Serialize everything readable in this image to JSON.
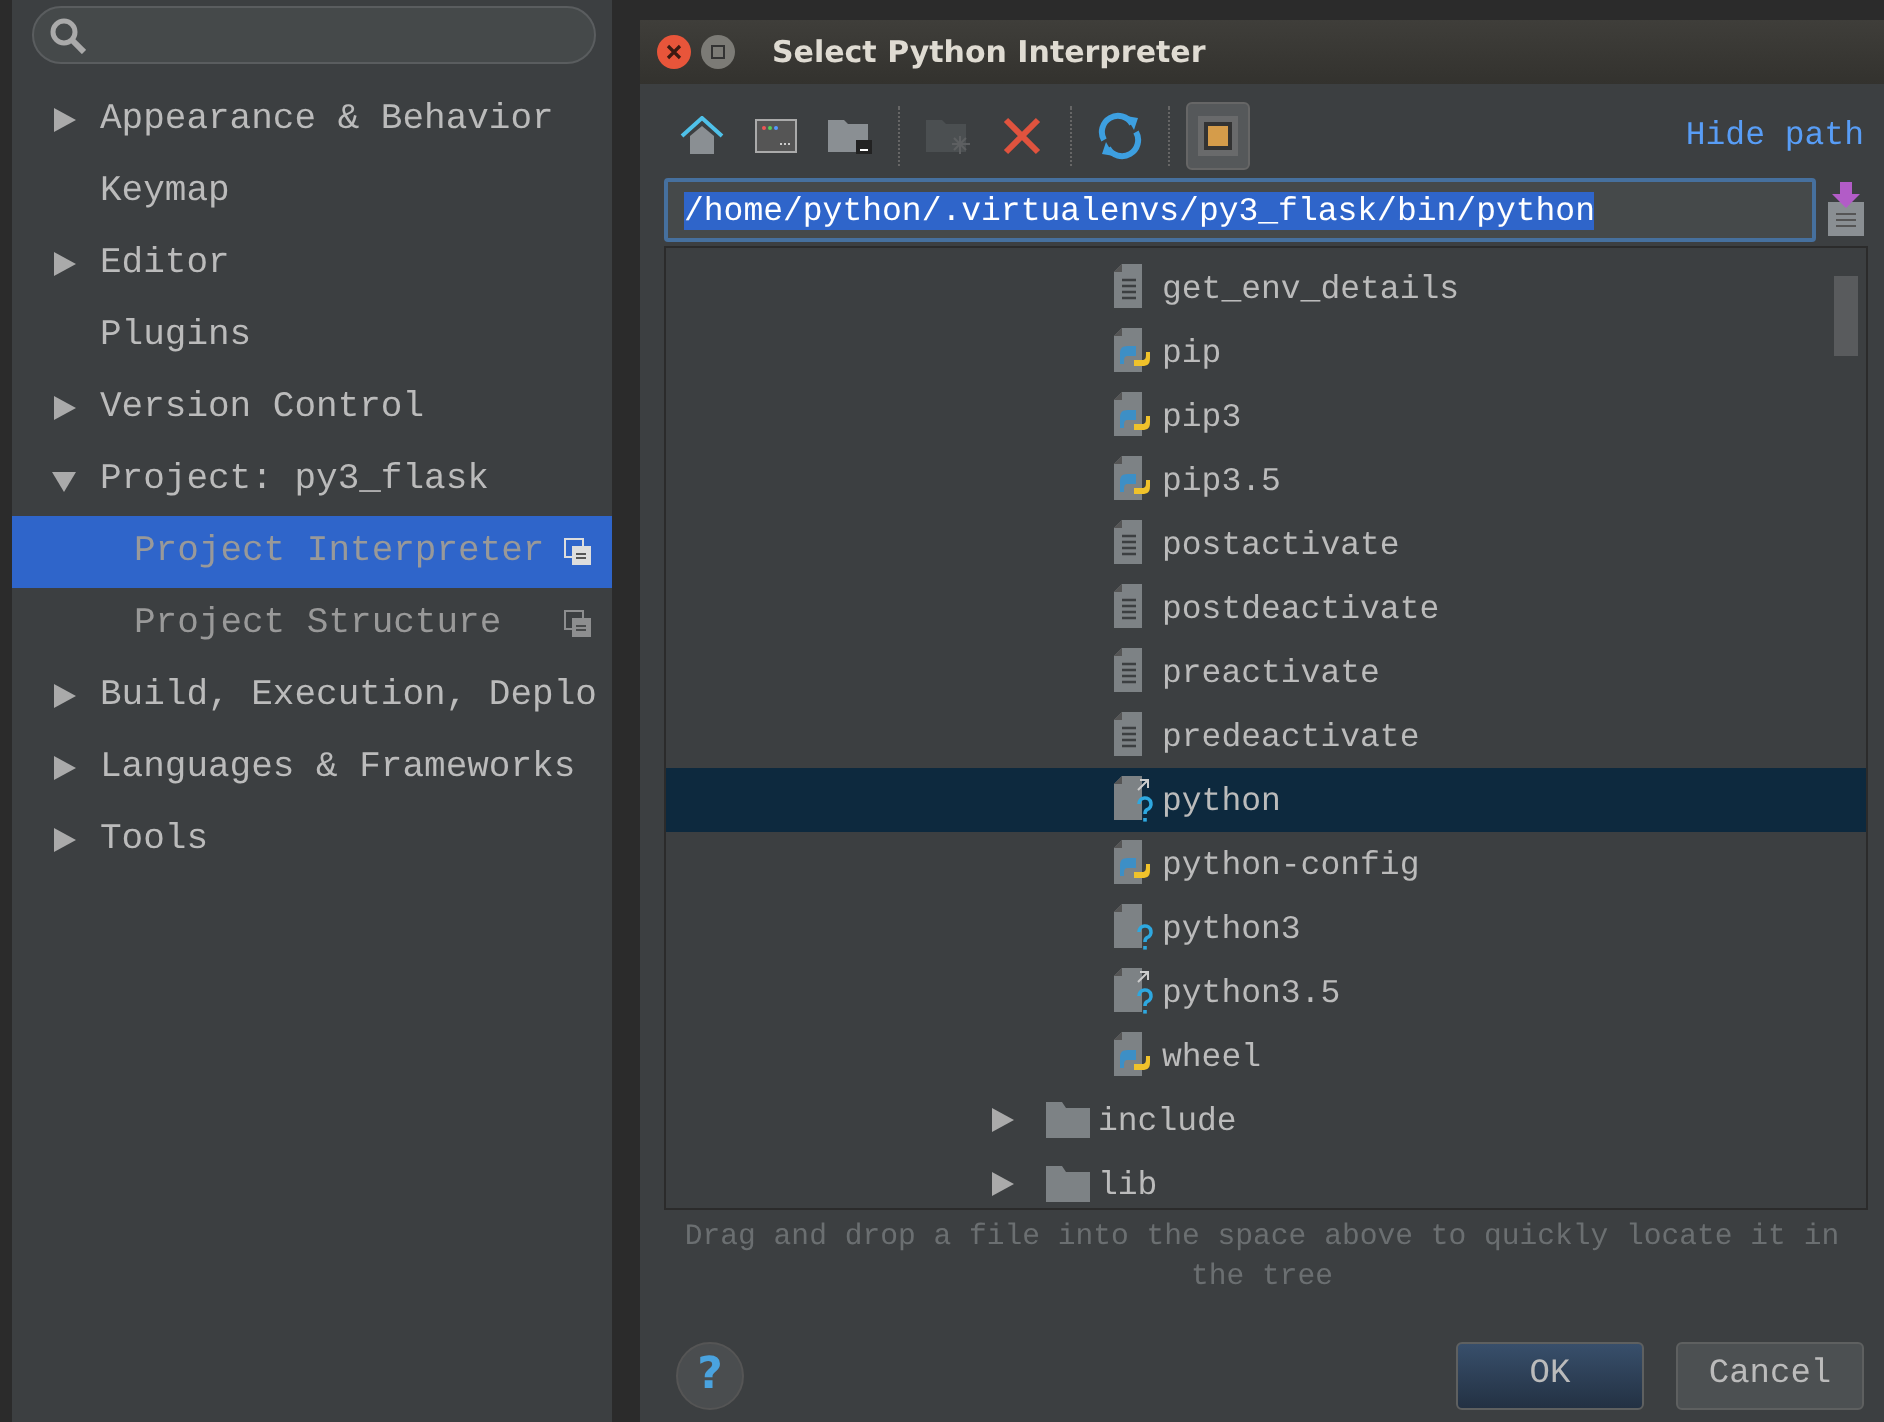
{
  "sidebar": {
    "items": [
      {
        "label": "Appearance & Behavior",
        "expandable": true,
        "expanded": false
      },
      {
        "label": "Keymap",
        "expandable": false
      },
      {
        "label": "Editor",
        "expandable": true,
        "expanded": false
      },
      {
        "label": "Plugins",
        "expandable": false
      },
      {
        "label": "Version Control",
        "expandable": true,
        "expanded": false
      },
      {
        "label": "Project: py3_flask",
        "expandable": true,
        "expanded": true,
        "children": [
          {
            "label": "Project Interpreter",
            "selected": true
          },
          {
            "label": "Project Structure",
            "selected": false
          }
        ]
      },
      {
        "label": "Build, Execution, Deplo",
        "expandable": true,
        "expanded": false
      },
      {
        "label": "Languages & Frameworks",
        "expandable": true,
        "expanded": false
      },
      {
        "label": "Tools",
        "expandable": true,
        "expanded": false
      }
    ]
  },
  "dialog": {
    "title": "Select Python Interpreter",
    "toolbar": [
      {
        "kind": "home",
        "disabled": false,
        "pressed": false
      },
      {
        "kind": "desktop",
        "disabled": false,
        "pressed": false
      },
      {
        "kind": "module",
        "disabled": false,
        "pressed": false
      },
      {
        "kind": "separator"
      },
      {
        "kind": "new-folder",
        "disabled": true,
        "pressed": false
      },
      {
        "kind": "delete",
        "disabled": false,
        "pressed": false
      },
      {
        "kind": "separator"
      },
      {
        "kind": "refresh",
        "disabled": false,
        "pressed": false
      },
      {
        "kind": "separator"
      },
      {
        "kind": "hidden-files",
        "disabled": false,
        "pressed": true
      }
    ],
    "hide_path_link": "Hide path",
    "path": {
      "value": "/home/python/.virtualenvs/py3_flask/bin/python",
      "text_selected": true
    },
    "files": [
      {
        "name": "get_env_details",
        "kind": "text",
        "selected": false
      },
      {
        "name": "pip",
        "kind": "python",
        "selected": false
      },
      {
        "name": "pip3",
        "kind": "python",
        "selected": false
      },
      {
        "name": "pip3.5",
        "kind": "python",
        "selected": false
      },
      {
        "name": "postactivate",
        "kind": "text",
        "selected": false
      },
      {
        "name": "postdeactivate",
        "kind": "text",
        "selected": false
      },
      {
        "name": "preactivate",
        "kind": "text",
        "selected": false
      },
      {
        "name": "predeactivate",
        "kind": "text",
        "selected": false
      },
      {
        "name": "python",
        "kind": "link",
        "selected": true
      },
      {
        "name": "python-config",
        "kind": "python",
        "selected": false
      },
      {
        "name": "python3",
        "kind": "unknown",
        "selected": false
      },
      {
        "name": "python3.5",
        "kind": "link",
        "selected": false
      },
      {
        "name": "wheel",
        "kind": "python",
        "selected": false
      }
    ],
    "folders": [
      {
        "name": "include",
        "expanded": false
      },
      {
        "name": "lib",
        "expanded": false
      }
    ],
    "hint": "Drag and drop a file into the space above to quickly locate it in the tree",
    "help_button": "?",
    "buttons": [
      {
        "label": "OK",
        "default": true
      },
      {
        "label": "Cancel",
        "default": false
      }
    ]
  }
}
